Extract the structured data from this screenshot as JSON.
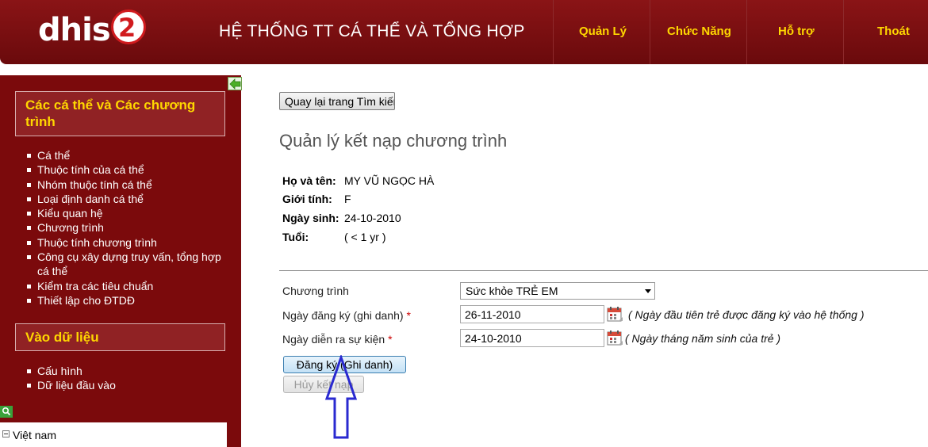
{
  "header": {
    "logo_text": "dhis",
    "logo_badge": "2",
    "system_title": "HỆ THỐNG TT CÁ THỂ VÀ TỔNG HỢP",
    "nav": [
      {
        "label": "Quản Lý"
      },
      {
        "label": "Chức Năng"
      },
      {
        "label": "Hỗ trợ"
      },
      {
        "label": "Thoát"
      }
    ],
    "nav_color": "#ffd700",
    "background": "#7b0a0c"
  },
  "sidebar": {
    "section1_title": "Các cá thể và Các chương trình",
    "section1_items": [
      {
        "label": "Cá thể"
      },
      {
        "label": "Thuộc tính của cá thể"
      },
      {
        "label": "Nhóm thuộc tính cá thể"
      },
      {
        "label": "Loại định danh cá thể"
      },
      {
        "label": "Kiểu quan hệ"
      },
      {
        "label": "Chương trình"
      },
      {
        "label": "Thuộc tính chương trình"
      },
      {
        "label": "Công cụ xây dựng truy vấn, tổng hợp cá thể"
      },
      {
        "label": "Kiểm tra các tiêu chuẩn"
      },
      {
        "label": "Thiết lập cho ĐTDĐ"
      }
    ],
    "section2_title": "Vào dữ liệu",
    "section2_items": [
      {
        "label": "Cấu hình"
      },
      {
        "label": "Dữ liệu đầu vào"
      }
    ],
    "tree_root": "Việt nam",
    "collapse_icon": "arrow-left-icon",
    "search_icon": "search-icon"
  },
  "main": {
    "back_button": "Quay lại trang Tìm kiếm",
    "title": "Quản lý kết nạp chương trình",
    "person": {
      "name_label": "Họ và tên:",
      "name_value": "MY VŨ NGỌC HÀ",
      "gender_label": "Giới tính:",
      "gender_value": "F",
      "dob_label": "Ngày sinh:",
      "dob_value": "24-10-2010",
      "age_label": "Tuổi:",
      "age_value": "( < 1 yr )"
    },
    "form": {
      "program_label": "Chương trình",
      "program_selected": "Sức khỏe TRẺ EM",
      "enroll_date_label": "Ngày đăng ký (ghi danh)",
      "enroll_date_value": "26-11-2010",
      "enroll_date_hint": "( Ngày đầu tiên trẻ được đăng ký vào hệ thống )",
      "incident_date_label": "Ngày diễn ra sự kiện",
      "incident_date_value": "24-10-2010",
      "incident_date_hint": "( Ngày tháng năm sinh của trẻ )",
      "required_mark": "*",
      "enroll_button": "Đăng ký (Ghi danh)",
      "cancel_button": "Hủy kết nạp"
    },
    "annotation_arrow_color": "#2a2ad0"
  }
}
